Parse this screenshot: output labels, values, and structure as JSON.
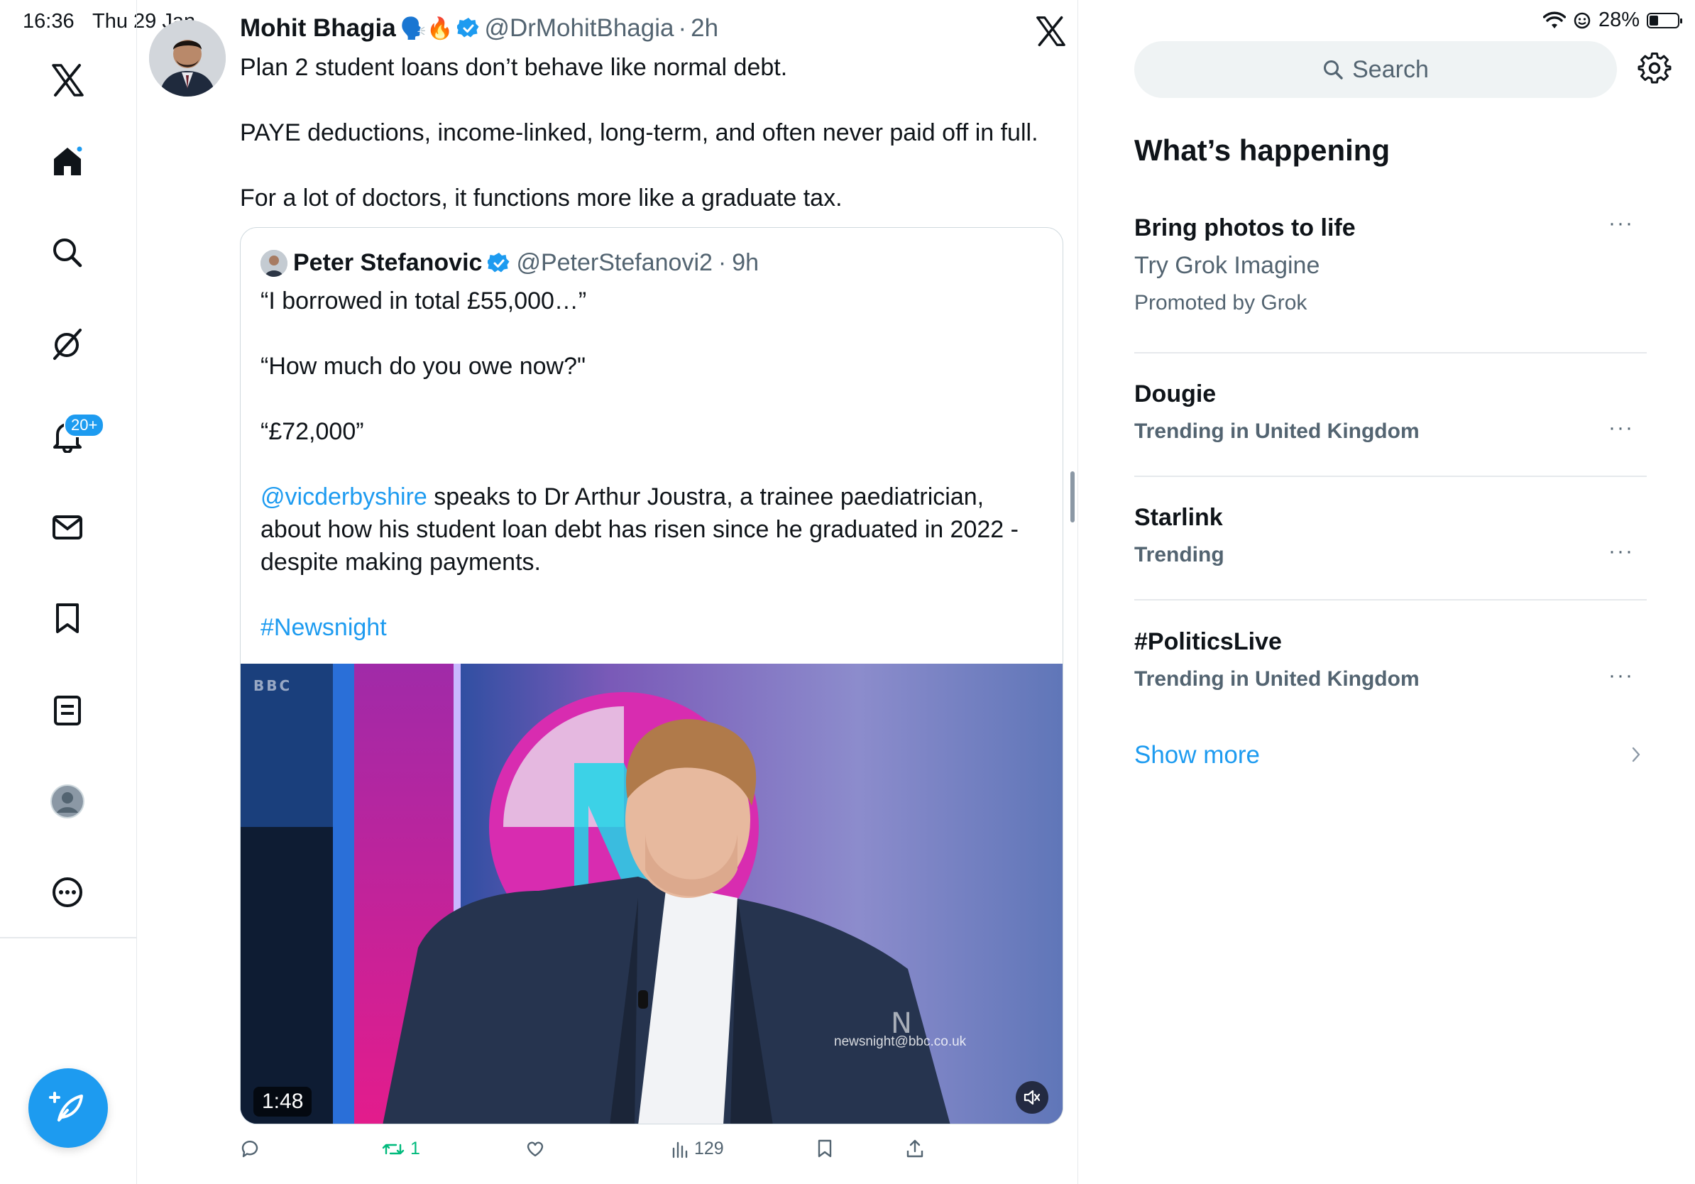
{
  "status_bar": {
    "time": "16:36",
    "date": "Thu 29 Jan",
    "battery": "28%",
    "battery_level": 0.28
  },
  "nav": {
    "notifications_badge": "20+",
    "items": [
      "x-logo-icon",
      "home-icon",
      "search-icon",
      "grok-icon",
      "notifications-icon",
      "messages-icon",
      "bookmarks-icon",
      "lists-icon",
      "profile-icon",
      "more-icon"
    ]
  },
  "tweet": {
    "author_name": "Mohit Bhagia",
    "author_emoji": "🗣️🔥",
    "handle": "@DrMohitBhagia",
    "separator": "·",
    "time": "2h",
    "text": [
      "Plan 2 student loans don’t behave like normal debt.",
      "PAYE deductions, income-linked, long-term, and often never paid off in full.",
      "For a lot of doctors, it functions more like a graduate tax."
    ],
    "quote": {
      "author_name": "Peter Stefanovic",
      "handle": "@PeterStefanovi2",
      "separator": "·",
      "time": "9h",
      "lines": {
        "l1": "“I borrowed in total £55,000…”",
        "l2": "“How much do you owe now?\"",
        "l3": "“£72,000”",
        "mention": "@vicderbyshire",
        "l4_rest": " speaks to Dr Arthur Joustra, a trainee paediatrician, about how his student loan debt has risen since he graduated in 2022 - despite making payments.",
        "hashtag": "#Newsnight"
      },
      "video": {
        "duration": "1:48",
        "channel_logo": "BBC",
        "watermark": "newsnight@bbc.co.uk"
      }
    },
    "actions": {
      "retweets": "1",
      "views": "129"
    }
  },
  "sidebar": {
    "search_placeholder": "Search",
    "heading": "What’s happening",
    "promo": {
      "title": "Bring photos to life",
      "subtitle": "Try Grok Imagine",
      "promoted": "Promoted by Grok"
    },
    "trends": [
      {
        "title": "Dougie",
        "context": "Trending in United Kingdom"
      },
      {
        "title": "Starlink",
        "context": "Trending"
      },
      {
        "title": "#PoliticsLive",
        "context": "Trending in United Kingdom"
      }
    ],
    "more_dots": "···",
    "show_more": "Show more"
  },
  "colors": {
    "accent": "#1d9bf0",
    "text": "#0f1419",
    "muted": "#536471",
    "retweet_green": "#00ba7c"
  }
}
